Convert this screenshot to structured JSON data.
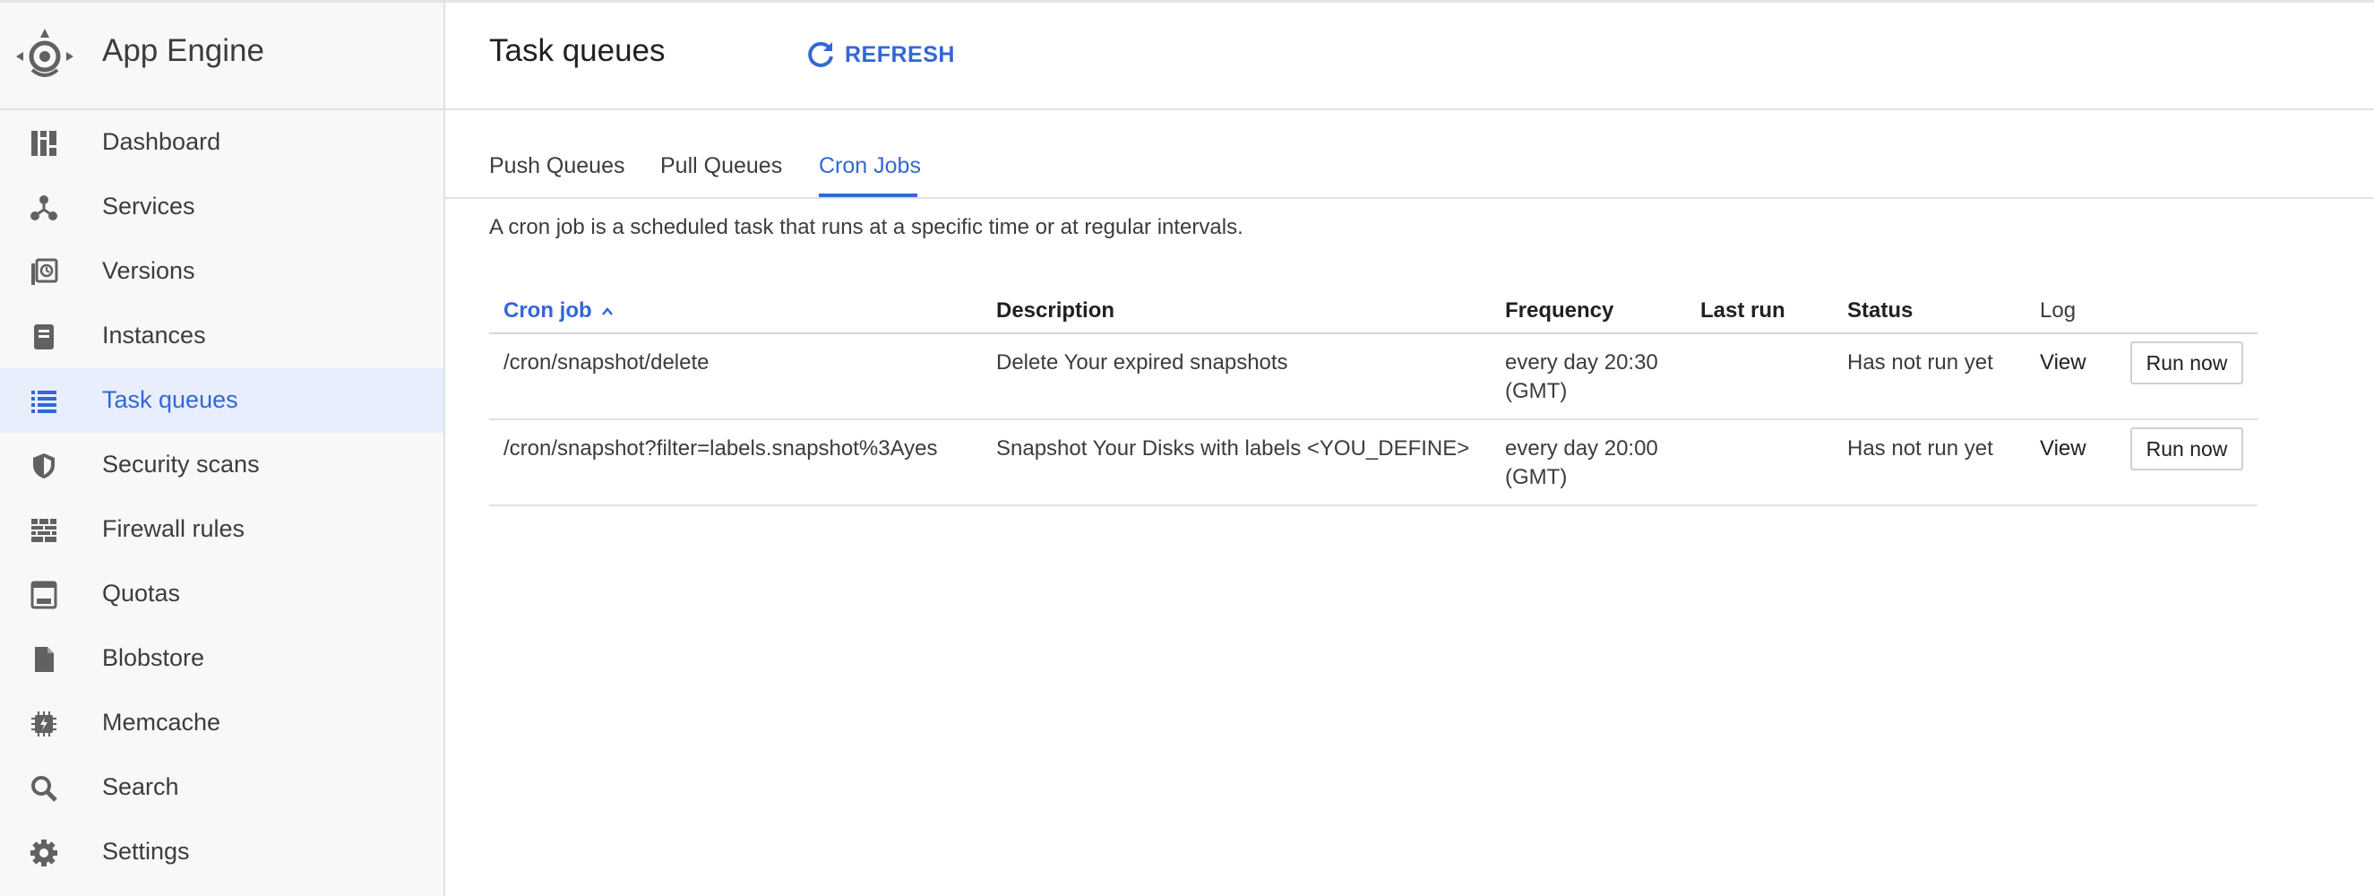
{
  "sidebar": {
    "app_title": "App Engine",
    "items": [
      {
        "label": "Dashboard",
        "icon": "dashboard-icon",
        "active": false
      },
      {
        "label": "Services",
        "icon": "services-icon",
        "active": false
      },
      {
        "label": "Versions",
        "icon": "versions-icon",
        "active": false
      },
      {
        "label": "Instances",
        "icon": "instances-icon",
        "active": false
      },
      {
        "label": "Task queues",
        "icon": "task-queues-icon",
        "active": true
      },
      {
        "label": "Security scans",
        "icon": "shield-icon",
        "active": false
      },
      {
        "label": "Firewall rules",
        "icon": "firewall-icon",
        "active": false
      },
      {
        "label": "Quotas",
        "icon": "quotas-icon",
        "active": false
      },
      {
        "label": "Blobstore",
        "icon": "document-icon",
        "active": false
      },
      {
        "label": "Memcache",
        "icon": "memcache-icon",
        "active": false
      },
      {
        "label": "Search",
        "icon": "search-icon",
        "active": false
      },
      {
        "label": "Settings",
        "icon": "gear-icon",
        "active": false
      }
    ]
  },
  "header": {
    "title": "Task queues",
    "refresh_label": "REFRESH"
  },
  "tabs": [
    {
      "label": "Push Queues",
      "active": false
    },
    {
      "label": "Pull Queues",
      "active": false
    },
    {
      "label": "Cron Jobs",
      "active": true
    }
  ],
  "intro": "A cron job is a scheduled task that runs at a specific time or at regular intervals.",
  "table": {
    "columns": [
      "Cron job",
      "Description",
      "Frequency",
      "Last run",
      "Status",
      "Log"
    ],
    "rows": [
      {
        "cron_job": "/cron/snapshot/delete",
        "description": "Delete Your expired snapshots",
        "frequency": "every day 20:30 (GMT)",
        "last_run": "",
        "status": "Has not run yet",
        "log": "View",
        "action": "Run now"
      },
      {
        "cron_job": "/cron/snapshot?filter=labels.snapshot%3Ayes",
        "description": "Snapshot Your Disks with labels <YOU_DEFINE>",
        "frequency": "every day 20:00 (GMT)",
        "last_run": "",
        "status": "Has not run yet",
        "log": "View",
        "action": "Run now"
      }
    ]
  },
  "colors": {
    "accent": "#3367d6",
    "sidebar_bg": "#f8f8f8",
    "active_bg": "#e8eefb",
    "icon": "#616161"
  }
}
